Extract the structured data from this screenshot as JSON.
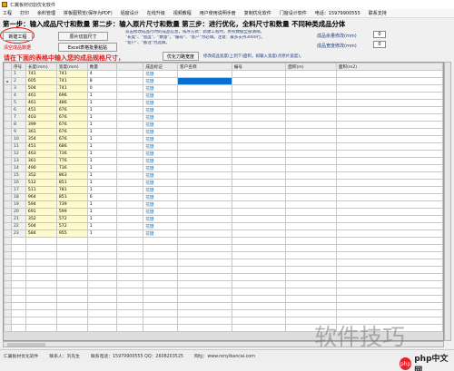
{
  "window": {
    "title": "仁翼板材切割优化软件"
  },
  "menu": [
    "工程",
    "打印",
    "余料管理",
    "拼板图预览(保存为PDF)",
    "铝窗设计",
    "在线升级",
    "视频教程",
    "用户使用说明手册",
    "复制优化软件",
    "门窗设计软件",
    "电话：15979900555",
    "联系支持"
  ],
  "steps": "第一步：输入成品尺寸和数量  第二步：输入原片尺寸和数量  第三步：进行优化，全料尺寸和数量  不同种类成品分体",
  "toolbar": {
    "new_project": "新建工程",
    "clear_data": "清空成品数据",
    "cut_size": "原片切割尺寸",
    "excel_import": "Excel表格批量粘贴",
    "modify_width": "优化刀路宽度",
    "modify_note": "修改成品宽度(上到下)面积，如输入宽度(点原片宽度)。",
    "param1_label": "成品余量修改(mm)",
    "param1_value": "0",
    "param2_label": "成品宽度修改(mm)",
    "param2_value": "0"
  },
  "info_lines": [
    "双击修改成品行时的成品信息，排序方式：新建工程时，原有数据全部清除。",
    "\"长度\"、\"宽度\"、\"数量\"，\"编号\"、\"客户\"为必填。注意：最多支持3000行。",
    "\"客户\"、\"备注\"为选填。"
  ],
  "hint": "请在下面的表格中输入您的成品规格尺寸，",
  "table": {
    "columns": [
      "序号",
      "长度(mm)",
      "宽度(mm)",
      "数量",
      "",
      "成品标记",
      "客户名称",
      "编号",
      "面积(m)",
      "面积(m2)"
    ],
    "rows": [
      [
        "1",
        "741",
        "741",
        "4",
        "",
        "花键"
      ],
      [
        "2",
        "605",
        "741",
        "8",
        "",
        "花键"
      ],
      [
        "3",
        "504",
        "741",
        "0",
        "",
        "花键"
      ],
      [
        "4",
        "461",
        "696",
        "1",
        "",
        "花键"
      ],
      [
        "5",
        "461",
        "486",
        "1",
        "",
        "花键"
      ],
      [
        "6",
        "451",
        "676",
        "1",
        "",
        "花键"
      ],
      [
        "7",
        "403",
        "676",
        "1",
        "",
        "花键"
      ],
      [
        "8",
        "399",
        "676",
        "1",
        "",
        "花键"
      ],
      [
        "9",
        "361",
        "676",
        "1",
        "",
        "花键"
      ],
      [
        "10",
        "354",
        "676",
        "1",
        "",
        "花键"
      ],
      [
        "11",
        "451",
        "686",
        "1",
        "",
        "花键"
      ],
      [
        "12",
        "463",
        "736",
        "1",
        "",
        "花键"
      ],
      [
        "13",
        "361",
        "776",
        "1",
        "",
        "花键"
      ],
      [
        "14",
        "490",
        "736",
        "1",
        "",
        "花键"
      ],
      [
        "15",
        "352",
        "863",
        "1",
        "",
        "花键"
      ],
      [
        "16",
        "512",
        "851",
        "1",
        "",
        "花键"
      ],
      [
        "17",
        "511",
        "781",
        "1",
        "",
        "花键"
      ],
      [
        "18",
        "964",
        "851",
        "6",
        "",
        "花键"
      ],
      [
        "19",
        "594",
        "739",
        "1",
        "",
        "花键"
      ],
      [
        "20",
        "691",
        "599",
        "1",
        "",
        "花键"
      ],
      [
        "21",
        "352",
        "572",
        "1",
        "",
        "花键"
      ],
      [
        "22",
        "504",
        "572",
        "1",
        "",
        "花键"
      ],
      [
        "23",
        "584",
        "955",
        "1",
        "",
        "花键"
      ]
    ]
  },
  "status": [
    "仁翼板材优化软件",
    "联系人：刘先生",
    "联系电话：15979900555 QQ：2608203525",
    "网址：www.renyibancai.com"
  ],
  "watermark": {
    "text": "软件技巧",
    "logo_text": "php中文网"
  }
}
